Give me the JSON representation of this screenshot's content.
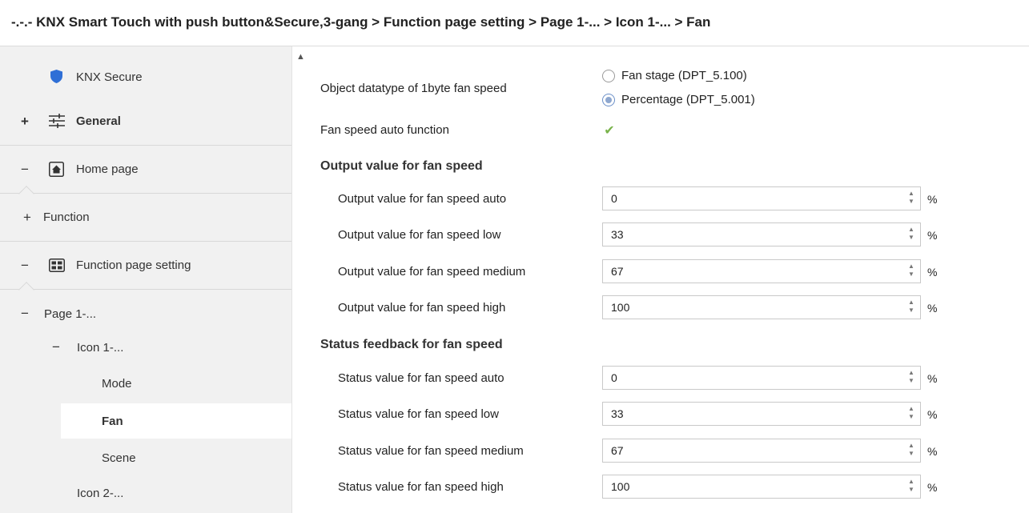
{
  "window": {
    "title": "-.-.- KNX Smart Touch with push button&Secure,3-gang > Function page setting > Page 1-... > Icon 1-... > Fan"
  },
  "sidebar": {
    "items": [
      {
        "label": "KNX Secure",
        "sign": "",
        "icon": "shield-icon"
      },
      {
        "label": "General",
        "sign": "+",
        "icon": "sliders-icon"
      },
      {
        "label": "Home page",
        "sign": "−",
        "icon": "home-icon"
      },
      {
        "label": "Function",
        "sign": "+",
        "icon": ""
      },
      {
        "label": "Function page setting",
        "sign": "−",
        "icon": "grid-icon"
      },
      {
        "label": "Page 1-...",
        "sign": "−",
        "icon": ""
      },
      {
        "label": "Icon 1-...",
        "sign": "−",
        "icon": ""
      },
      {
        "label": "Mode",
        "sign": "",
        "icon": ""
      },
      {
        "label": "Fan",
        "sign": "",
        "icon": "",
        "selected": true
      },
      {
        "label": "Scene",
        "sign": "",
        "icon": ""
      },
      {
        "label": "Icon 2-...",
        "sign": "",
        "icon": ""
      }
    ]
  },
  "main": {
    "datatype": {
      "label": "Object datatype of 1byte fan speed",
      "options": [
        "Fan stage (DPT_5.100)",
        "Percentage (DPT_5.001)"
      ],
      "selected": "Percentage (DPT_5.001)"
    },
    "auto_function": {
      "label": "Fan speed auto function",
      "checked": true
    },
    "output_section": {
      "title": "Output value for fan speed",
      "rows": [
        {
          "label": "Output value for fan speed auto",
          "value": "0",
          "unit": "%"
        },
        {
          "label": "Output value for fan speed low",
          "value": "33",
          "unit": "%"
        },
        {
          "label": "Output value for fan speed medium",
          "value": "67",
          "unit": "%"
        },
        {
          "label": "Output value for fan speed high",
          "value": "100",
          "unit": "%"
        }
      ]
    },
    "status_section": {
      "title": "Status feedback for fan speed",
      "rows": [
        {
          "label": "Status value for fan speed auto",
          "value": "0",
          "unit": "%"
        },
        {
          "label": "Status value for fan speed low",
          "value": "33",
          "unit": "%"
        },
        {
          "label": "Status value for fan speed medium",
          "value": "67",
          "unit": "%"
        },
        {
          "label": "Status value for fan speed high",
          "value": "100",
          "unit": "%"
        }
      ]
    }
  },
  "colors": {
    "accent_check": "#79b34a",
    "shield": "#2f6fd6",
    "sidebar_bg": "#f1f1f1"
  }
}
